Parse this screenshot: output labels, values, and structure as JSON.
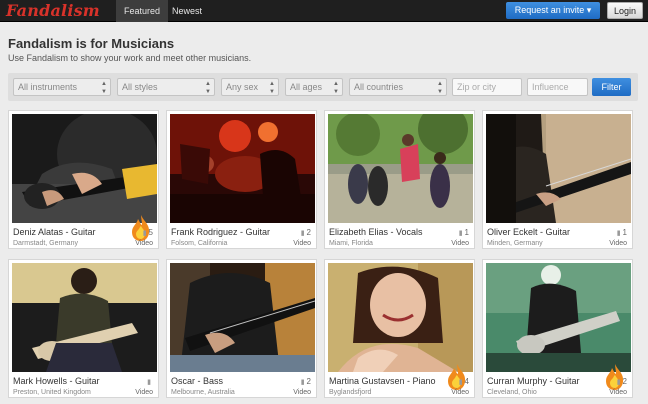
{
  "nav": {
    "logo": "Fandalism",
    "tabs": [
      {
        "label": "Featured",
        "active": true
      },
      {
        "label": "Newest",
        "active": false
      }
    ],
    "invite_label": "Request an invite ▾",
    "login_label": "Login"
  },
  "header": {
    "title": "Fandalism is for Musicians",
    "subtitle": "Use Fandalism to show your work and meet other musicians."
  },
  "filters": {
    "instruments": "All instruments",
    "styles": "All styles",
    "sex": "Any sex",
    "ages": "All ages",
    "countries": "All countries",
    "zip_placeholder": "Zip or city",
    "influence_placeholder": "Influence",
    "filter_label": "Filter"
  },
  "cards": [
    {
      "name": "Deniz Alatas - Guitar",
      "location": "Darmstadt, Germany",
      "count": "5",
      "type": "Video",
      "hot": true
    },
    {
      "name": "Frank Rodriguez - Guitar",
      "location": "Folsom, California",
      "count": "2",
      "type": "Video",
      "hot": false
    },
    {
      "name": "Elizabeth Elias - Vocals",
      "location": "Miami, Florida",
      "count": "1",
      "type": "Video",
      "hot": false
    },
    {
      "name": "Oliver Eckelt - Guitar",
      "location": "Minden, Germany",
      "count": "1",
      "type": "Video",
      "hot": false
    },
    {
      "name": "Mark Howells - Guitar",
      "location": "Preston, United Kingdom",
      "count": "",
      "type": "Video",
      "hot": false
    },
    {
      "name": "Oscar - Bass",
      "location": "Melbourne, Australia",
      "count": "2",
      "type": "Video",
      "hot": false
    },
    {
      "name": "Martina Gustavsen - Piano",
      "location": "Byglandsfjord",
      "count": "4",
      "type": "Video",
      "hot": true
    },
    {
      "name": "Curran Murphy - Guitar",
      "location": "Cleveland, Ohio",
      "count": "2",
      "type": "Video",
      "hot": true
    }
  ],
  "colors": {
    "brand": "#d8322a",
    "accent": "#1f6cc4"
  },
  "icons": {
    "comment": "comment-icon",
    "hot": "flame-icon",
    "select": "select-arrows-icon"
  }
}
